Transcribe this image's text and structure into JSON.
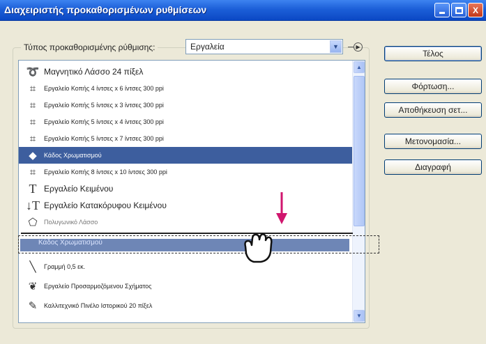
{
  "window": {
    "title": "Διαχειριστής προκαθορισμένων ρυθμίσεων",
    "controls": {
      "minimize": "_",
      "maximize": "□",
      "close": "X"
    }
  },
  "preset_type": {
    "label": "Τύπος προκαθορισμένης ρύθμισης:",
    "value": "Εργαλεία"
  },
  "list": {
    "items": [
      {
        "label": "Μαγνητικό Λάσσο 24 πίξελ",
        "icon": "magnetic-lasso-icon",
        "small": false
      },
      {
        "label": "Εργαλείο Κοπής 4 ίντσες x 6 ίντσες 300 ppi",
        "icon": "crop-icon",
        "small": true
      },
      {
        "label": "Εργαλείο Κοπής 5 ίντσες x 3 ίντσες 300 ppi",
        "icon": "crop-icon",
        "small": true
      },
      {
        "label": "Εργαλείο Κοπής 5 ίντσες x 4 ίντσες 300 ppi",
        "icon": "crop-icon",
        "small": true
      },
      {
        "label": "Εργαλείο Κοπής 5 ίντσες x 7 ίντσες 300 ppi",
        "icon": "crop-icon",
        "small": true
      },
      {
        "label": "Κάδος Χρωματισμού",
        "icon": "paint-bucket-icon",
        "small": true,
        "selected": true
      },
      {
        "label": "Εργαλείο Κοπής 8 ίντσες x 10 ίντσες 300 ppi",
        "icon": "crop-icon",
        "small": true
      },
      {
        "label": "Εργαλείο Κειμένου",
        "icon": "type-icon",
        "small": false
      },
      {
        "label": "Εργαλείο Κατακόρυφου Κειμένου",
        "icon": "vertical-type-icon",
        "small": false
      },
      {
        "label": "Πολυγωνικό Λάσσο",
        "icon": "polygonal-lasso-icon",
        "small": true
      },
      {
        "label": "Γραμμή 0,5 εκ.",
        "icon": "line-icon",
        "small": true
      },
      {
        "label": "Εργαλείο Προσαρμοζόμενου Σχήματος",
        "icon": "custom-shape-icon",
        "small": true
      },
      {
        "label": "Καλλιτεχνικό Πινέλο Ιστορικού 20 πίξελ",
        "icon": "art-history-brush-icon",
        "small": true
      }
    ],
    "drag_ghost_label": "Κάδος Χρωματισμού"
  },
  "buttons": {
    "ok": "Τέλος",
    "load": "Φόρτωση...",
    "save": "Αποθήκευση σετ...",
    "rename": "Μετονομασία...",
    "delete": "Διαγραφή"
  },
  "colors": {
    "selection": "#3d5e9e",
    "titlebar": "#1c5fd8",
    "drop_arrow": "#d0166e"
  }
}
